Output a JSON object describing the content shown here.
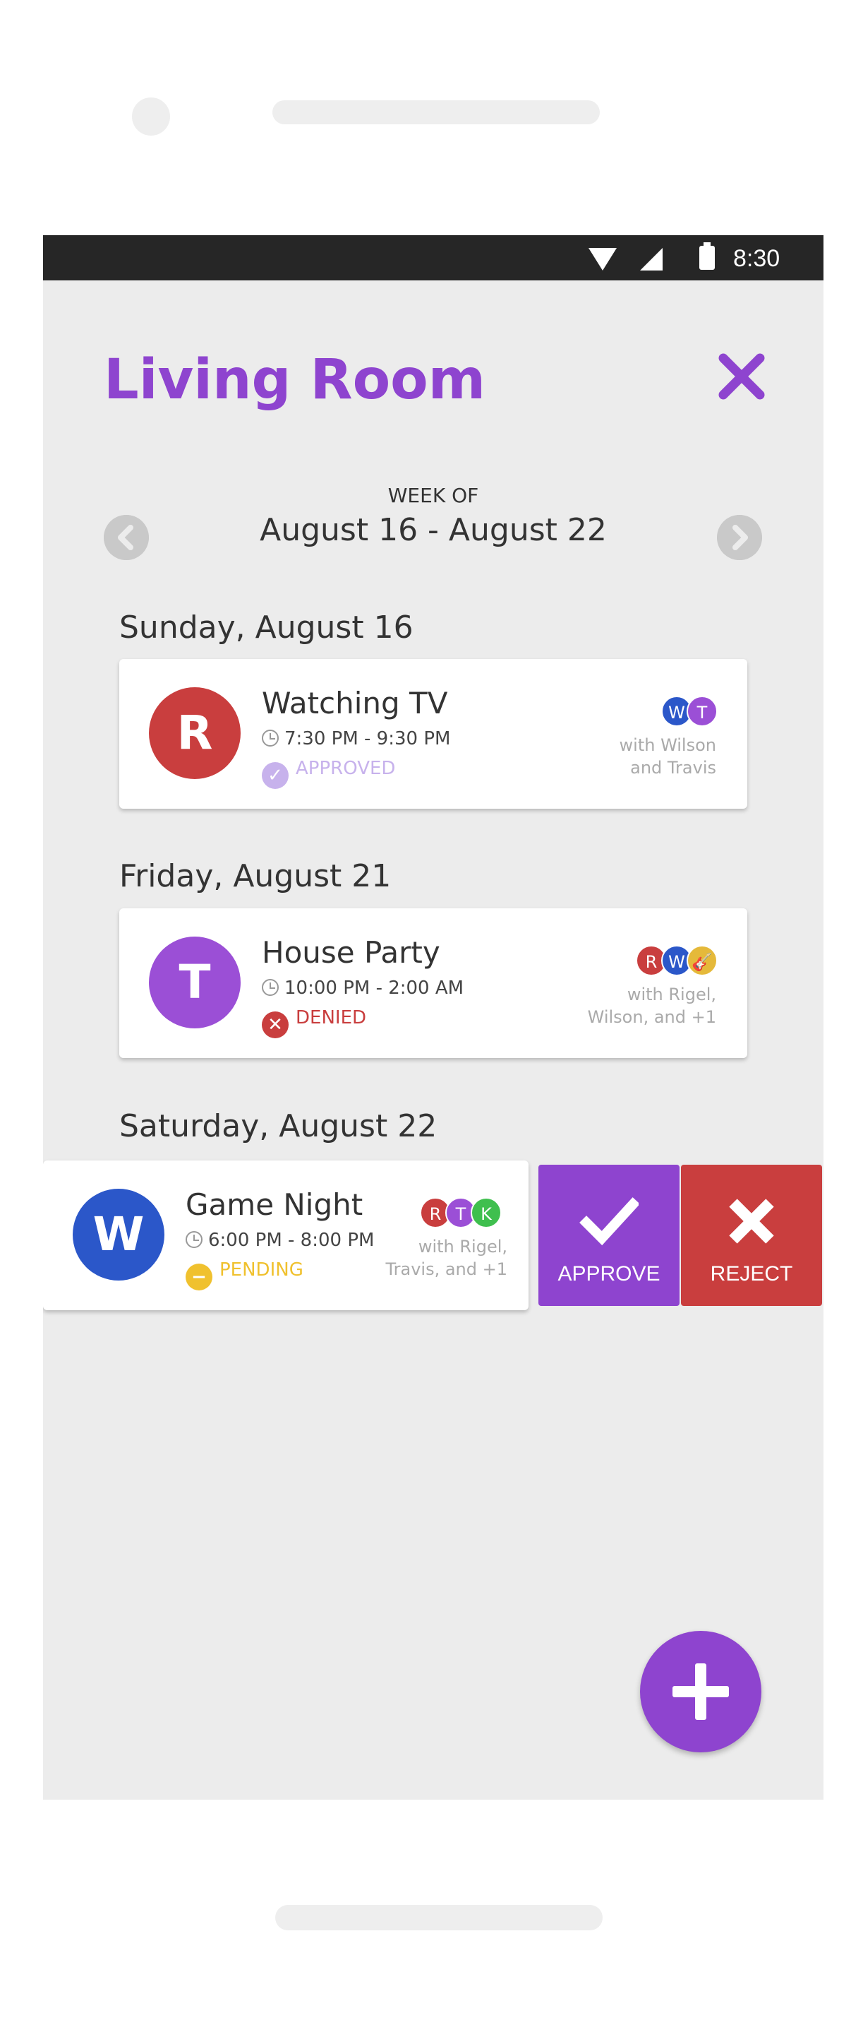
{
  "status_bar": {
    "time": "8:30"
  },
  "header": {
    "title": "Living Room"
  },
  "week": {
    "label": "WEEK OF",
    "range": "August 16 - August 22"
  },
  "days": [
    {
      "heading": "Sunday, August 16",
      "event": {
        "avatar_letter": "R",
        "avatar_color": "#c93e3e",
        "title": "Watching TV",
        "time": "7:30 PM - 9:30 PM",
        "status": "APPROVED",
        "status_color": "#c7b2ec",
        "participants": [
          {
            "letter": "W",
            "color": "#2b57c9"
          },
          {
            "letter": "T",
            "color": "#9b4fd6"
          }
        ],
        "with_line1": "with Wilson",
        "with_line2": "and Travis"
      }
    },
    {
      "heading": "Friday, August 21",
      "event": {
        "avatar_letter": "T",
        "avatar_color": "#9b4fd6",
        "title": "House Party",
        "time": "10:00 PM - 2:00 AM",
        "status": "DENIED",
        "status_color": "#c93e3e",
        "participants": [
          {
            "letter": "R",
            "color": "#c93e3e"
          },
          {
            "letter": "W",
            "color": "#2b57c9"
          },
          {
            "letter": "🎸",
            "color": "#e5b93a"
          }
        ],
        "with_line1": "with Rigel,",
        "with_line2": "Wilson, and +1"
      }
    },
    {
      "heading": "Saturday, August 22",
      "event": {
        "avatar_letter": "W",
        "avatar_color": "#2b57c9",
        "title": "Game Night",
        "time": "6:00 PM - 8:00 PM",
        "status": "PENDING",
        "status_color": "#f0c12e",
        "participants": [
          {
            "letter": "R",
            "color": "#c93e3e"
          },
          {
            "letter": "T",
            "color": "#9b4fd6"
          },
          {
            "letter": "K",
            "color": "#3fbf4e"
          }
        ],
        "with_line1": "with Rigel,",
        "with_line2": "Travis, and +1"
      }
    }
  ],
  "actions": {
    "approve_label": "APPROVE",
    "approve_color": "#8e44cf",
    "reject_label": "REJECT",
    "reject_color": "#c93e3e"
  },
  "icons": {
    "close": "close-icon",
    "prev": "chevron-left-icon",
    "next": "chevron-right-icon",
    "fab": "plus-icon"
  }
}
